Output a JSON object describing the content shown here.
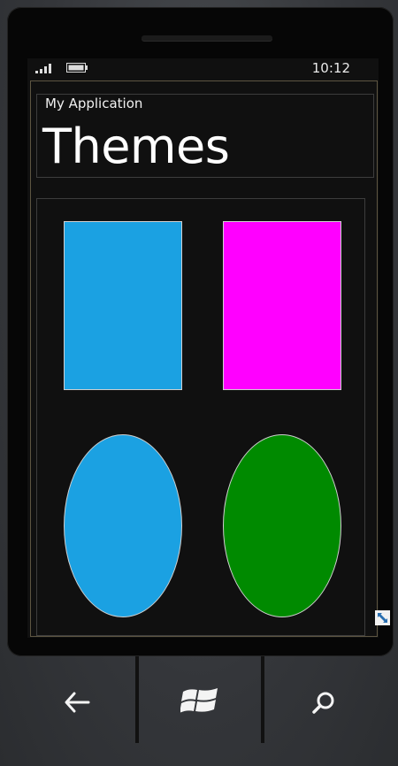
{
  "status_bar": {
    "time": "10:12",
    "signal_icon": "signal-bars-icon",
    "battery_icon": "battery-icon"
  },
  "header": {
    "app_name": "My Application",
    "page_title": "Themes"
  },
  "shapes": [
    {
      "kind": "rectangle",
      "color": "#1ba1e2"
    },
    {
      "kind": "rectangle",
      "color": "#ff00ff"
    },
    {
      "kind": "ellipse",
      "color": "#1ba1e2"
    },
    {
      "kind": "ellipse",
      "color": "#008a00"
    }
  ],
  "emulator": {
    "fullscreen_icon": "fullscreen-toggle-icon"
  },
  "navbar": {
    "back_icon": "back-arrow-icon",
    "start_icon": "windows-logo-icon",
    "search_icon": "search-icon"
  }
}
